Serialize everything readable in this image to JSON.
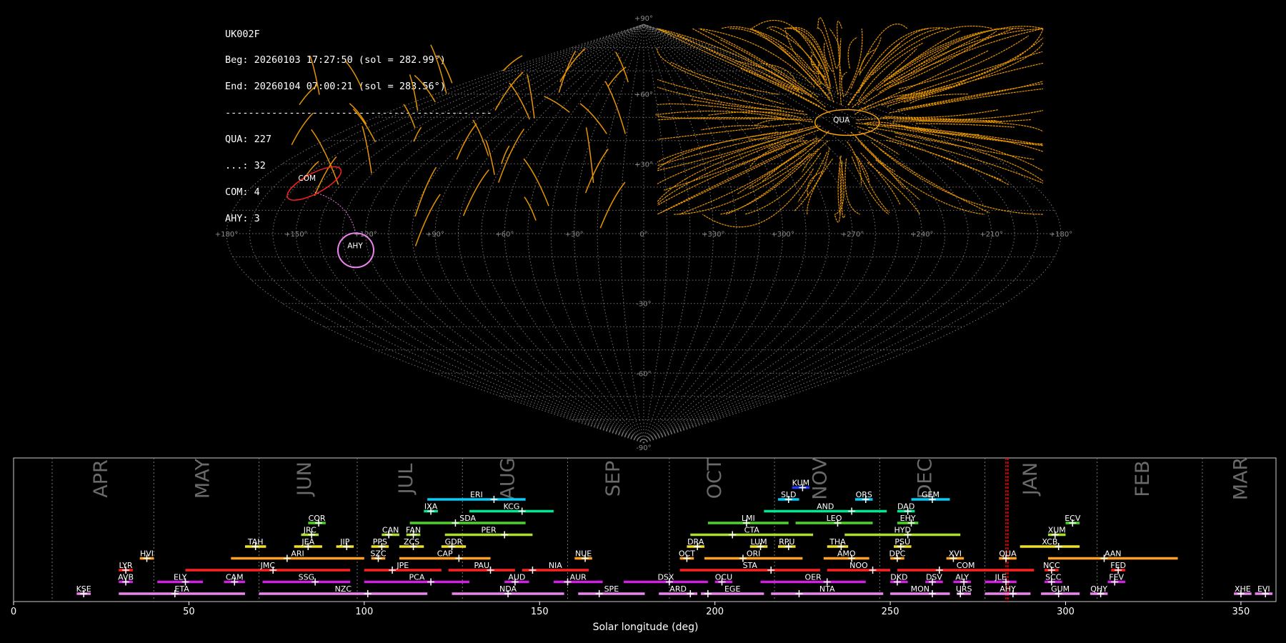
{
  "info": {
    "camera": "UK002F",
    "beg": "Beg: 20260103 17:27:50 (sol = 282.99°)",
    "end": "End: 20260104 07:00:21 (sol = 283.56°)",
    "separator": "----------------------------------------------",
    "counts": [
      "QUA: 227",
      "...: 32",
      "COM: 4",
      "AHY: 3"
    ]
  },
  "colors": {
    "background": "#000000",
    "grid": "#8c8c8c",
    "sporadic": "#ffa500",
    "QUA": "#ff2020",
    "COM": "#ff2020",
    "AHY": "#ee82ee",
    "current_sol": "#ff0000"
  },
  "chart_data": [
    {
      "type": "scatter",
      "projection": "sinusoidal",
      "grid": true,
      "lat_ticks": [
        90,
        60,
        30,
        -30,
        -60,
        -90
      ],
      "lat_labels": [
        "+90°",
        "+60°",
        "+30°",
        "-30°",
        "-60°",
        "-90°"
      ],
      "lon_ticks": [
        180,
        150,
        120,
        90,
        60,
        30,
        0,
        330,
        300,
        270,
        240,
        210,
        180
      ],
      "lon_labels": [
        "+180°",
        "+150°",
        "+120°",
        "+90°",
        "+60°",
        "+30°",
        "0°",
        "+330°",
        "+300°",
        "+270°",
        "+240°",
        "+210°",
        "+180°"
      ],
      "showers": [
        {
          "code": "QUA",
          "lon": 230,
          "lat": 49
        },
        {
          "code": "COM",
          "lon": 159,
          "lat": 24
        },
        {
          "code": "AHY",
          "lon": 125,
          "lat": -5
        }
      ]
    },
    {
      "type": "timeline",
      "xlabel": "Solar longitude (deg)",
      "xlim": [
        0,
        360
      ],
      "xticks": [
        0,
        50,
        100,
        150,
        200,
        250,
        300,
        350
      ],
      "month_lines": [
        11,
        40,
        70,
        98,
        128,
        158,
        187,
        217,
        247,
        277,
        309,
        339
      ],
      "months": [
        {
          "name": "APR",
          "sol": 25
        },
        {
          "name": "MAY",
          "sol": 54
        },
        {
          "name": "JUN",
          "sol": 83
        },
        {
          "name": "JUL",
          "sol": 112
        },
        {
          "name": "AUG",
          "sol": 141
        },
        {
          "name": "SEP",
          "sol": 171
        },
        {
          "name": "OCT",
          "sol": 200
        },
        {
          "name": "NOV",
          "sol": 230
        },
        {
          "name": "DEC",
          "sol": 260
        },
        {
          "name": "JAN",
          "sol": 290
        },
        {
          "name": "FEB",
          "sol": 322
        },
        {
          "name": "MAR",
          "sol": 350
        }
      ],
      "current_sol": [
        282.99,
        283.56
      ],
      "showers": [
        {
          "code": "KUM",
          "start": 222,
          "end": 227,
          "peak": 225,
          "row": 9,
          "color": "#1e3cff"
        },
        {
          "code": "ERI",
          "start": 118,
          "end": 146,
          "peak": 137,
          "row": 8,
          "color": "#00d0ff"
        },
        {
          "code": "SLD",
          "start": 218,
          "end": 224,
          "peak": 221,
          "row": 8,
          "color": "#00d0ff"
        },
        {
          "code": "ORS",
          "start": 240,
          "end": 245,
          "peak": 243,
          "row": 8,
          "color": "#00d0ff"
        },
        {
          "code": "GEM",
          "start": 256,
          "end": 267,
          "peak": 262,
          "row": 8,
          "color": "#00d0ff"
        },
        {
          "code": "IXA",
          "start": 117,
          "end": 121,
          "peak": 119,
          "row": 7,
          "color": "#00e890"
        },
        {
          "code": "KCG",
          "start": 130,
          "end": 154,
          "peak": 145,
          "row": 7,
          "color": "#00e890"
        },
        {
          "code": "AND",
          "start": 214,
          "end": 249,
          "peak": 239,
          "row": 7,
          "color": "#00e890"
        },
        {
          "code": "DAD",
          "start": 252,
          "end": 257,
          "peak": 255,
          "row": 7,
          "color": "#00e890"
        },
        {
          "code": "COR",
          "start": 84,
          "end": 89,
          "peak": 87,
          "row": 6,
          "color": "#50d030"
        },
        {
          "code": "SDA",
          "start": 113,
          "end": 146,
          "peak": 126,
          "row": 6,
          "color": "#50d030"
        },
        {
          "code": "LMI",
          "start": 198,
          "end": 221,
          "peak": 209,
          "row": 6,
          "color": "#50d030"
        },
        {
          "code": "LEO",
          "start": 223,
          "end": 245,
          "peak": 235,
          "row": 6,
          "color": "#50d030"
        },
        {
          "code": "EHY",
          "start": 252,
          "end": 258,
          "peak": 256,
          "row": 6,
          "color": "#50d030"
        },
        {
          "code": "ECV",
          "start": 300,
          "end": 304,
          "peak": 302,
          "row": 6,
          "color": "#50d030"
        },
        {
          "code": "JRC",
          "start": 82,
          "end": 87,
          "peak": 85,
          "row": 5,
          "color": "#a8e030"
        },
        {
          "code": "CAN",
          "start": 105,
          "end": 110,
          "peak": 107,
          "row": 5,
          "color": "#a8e030"
        },
        {
          "code": "FAN",
          "start": 112,
          "end": 116,
          "peak": 114,
          "row": 5,
          "color": "#a8e030"
        },
        {
          "code": "PER",
          "start": 123,
          "end": 148,
          "peak": 140,
          "row": 5,
          "color": "#a8e030"
        },
        {
          "code": "CTA",
          "start": 193,
          "end": 228,
          "peak": 205,
          "row": 5,
          "color": "#a8e030"
        },
        {
          "code": "HYD",
          "start": 237,
          "end": 270,
          "peak": 255,
          "row": 5,
          "color": "#a8e030"
        },
        {
          "code": "XUM",
          "start": 295,
          "end": 300,
          "peak": 297,
          "row": 5,
          "color": "#a8e030"
        },
        {
          "code": "TAH",
          "start": 66,
          "end": 72,
          "peak": 69,
          "row": 4,
          "color": "#f0e020"
        },
        {
          "code": "JEA",
          "start": 80,
          "end": 88,
          "peak": 84,
          "row": 4,
          "color": "#f0e020"
        },
        {
          "code": "JIP",
          "start": 92,
          "end": 97,
          "peak": 95,
          "row": 4,
          "color": "#f0e020"
        },
        {
          "code": "PPS",
          "start": 102,
          "end": 107,
          "peak": 105,
          "row": 4,
          "color": "#f0e020"
        },
        {
          "code": "ZCS",
          "start": 110,
          "end": 117,
          "peak": 114,
          "row": 4,
          "color": "#f0e020"
        },
        {
          "code": "GDR",
          "start": 122,
          "end": 129,
          "peak": 125,
          "row": 4,
          "color": "#f0e020"
        },
        {
          "code": "DRA",
          "start": 192,
          "end": 197,
          "peak": 195,
          "row": 4,
          "color": "#f0e020"
        },
        {
          "code": "LUM",
          "start": 210,
          "end": 215,
          "peak": 213,
          "row": 4,
          "color": "#f0e020"
        },
        {
          "code": "RPU",
          "start": 218,
          "end": 223,
          "peak": 221,
          "row": 4,
          "color": "#f0e020"
        },
        {
          "code": "THA",
          "start": 232,
          "end": 238,
          "peak": 236,
          "row": 4,
          "color": "#f0e020"
        },
        {
          "code": "PSU",
          "start": 251,
          "end": 256,
          "peak": 253,
          "row": 4,
          "color": "#f0e020"
        },
        {
          "code": "XCB",
          "start": 287,
          "end": 304,
          "peak": 298,
          "row": 4,
          "color": "#f0e020"
        },
        {
          "code": "HVI",
          "start": 36,
          "end": 40,
          "peak": 38,
          "row": 3,
          "color": "#ffa020"
        },
        {
          "code": "ARI",
          "start": 62,
          "end": 100,
          "peak": 78,
          "row": 3,
          "color": "#ffa020"
        },
        {
          "code": "SZC",
          "start": 102,
          "end": 106,
          "peak": 104,
          "row": 3,
          "color": "#ffa020"
        },
        {
          "code": "CAP",
          "start": 110,
          "end": 136,
          "peak": 127,
          "row": 3,
          "color": "#ffa020"
        },
        {
          "code": "NUE",
          "start": 160,
          "end": 165,
          "peak": 163,
          "row": 3,
          "color": "#ffa020"
        },
        {
          "code": "OCT",
          "start": 190,
          "end": 194,
          "peak": 192,
          "row": 3,
          "color": "#ffa020"
        },
        {
          "code": "ORI",
          "start": 197,
          "end": 225,
          "peak": 208,
          "row": 3,
          "color": "#ffa020"
        },
        {
          "code": "AMO",
          "start": 231,
          "end": 244,
          "peak": 239,
          "row": 3,
          "color": "#ffa020"
        },
        {
          "code": "DPC",
          "start": 250,
          "end": 254,
          "peak": 252,
          "row": 3,
          "color": "#ffa020"
        },
        {
          "code": "XVI",
          "start": 266,
          "end": 271,
          "peak": 268,
          "row": 3,
          "color": "#ffa020"
        },
        {
          "code": "QUA",
          "start": 281,
          "end": 286,
          "peak": 283,
          "row": 3,
          "color": "#ffa020"
        },
        {
          "code": "AAN",
          "start": 295,
          "end": 332,
          "peak": 311,
          "row": 3,
          "color": "#ffa020"
        },
        {
          "code": "LYR",
          "start": 30,
          "end": 34,
          "peak": 32,
          "row": 2,
          "color": "#ff2020"
        },
        {
          "code": "JMC",
          "start": 49,
          "end": 96,
          "peak": 74,
          "row": 2,
          "color": "#ff2020"
        },
        {
          "code": "JPE",
          "start": 100,
          "end": 122,
          "peak": 108,
          "row": 2,
          "color": "#ff2020"
        },
        {
          "code": "PAU",
          "start": 124,
          "end": 143,
          "peak": 136,
          "row": 2,
          "color": "#ff2020"
        },
        {
          "code": "NIA",
          "start": 145,
          "end": 164,
          "peak": 148,
          "row": 2,
          "color": "#ff2020"
        },
        {
          "code": "STA",
          "start": 190,
          "end": 230,
          "peak": 216,
          "row": 2,
          "color": "#ff2020"
        },
        {
          "code": "NOO",
          "start": 232,
          "end": 250,
          "peak": 245,
          "row": 2,
          "color": "#ff2020"
        },
        {
          "code": "COM",
          "start": 252,
          "end": 291,
          "peak": 264,
          "row": 2,
          "color": "#ff2020"
        },
        {
          "code": "NCC",
          "start": 294,
          "end": 298,
          "peak": 296,
          "row": 2,
          "color": "#ff2020"
        },
        {
          "code": "FED",
          "start": 313,
          "end": 317,
          "peak": 315,
          "row": 2,
          "color": "#ff2020"
        },
        {
          "code": "AVB",
          "start": 30,
          "end": 34,
          "peak": 32,
          "row": 1,
          "color": "#d020e0"
        },
        {
          "code": "ELY",
          "start": 41,
          "end": 54,
          "peak": 49,
          "row": 1,
          "color": "#d020e0"
        },
        {
          "code": "CAM",
          "start": 60,
          "end": 66,
          "peak": 63,
          "row": 1,
          "color": "#d020e0"
        },
        {
          "code": "SSG",
          "start": 71,
          "end": 96,
          "peak": 86,
          "row": 1,
          "color": "#d020e0"
        },
        {
          "code": "PCA",
          "start": 100,
          "end": 130,
          "peak": 119,
          "row": 1,
          "color": "#d020e0"
        },
        {
          "code": "AUD",
          "start": 140,
          "end": 147,
          "peak": 143,
          "row": 1,
          "color": "#d020e0"
        },
        {
          "code": "AUR",
          "start": 154,
          "end": 168,
          "peak": 158,
          "row": 1,
          "color": "#d020e0"
        },
        {
          "code": "DSX",
          "start": 174,
          "end": 198,
          "peak": 187,
          "row": 1,
          "color": "#d020e0"
        },
        {
          "code": "OCU",
          "start": 200,
          "end": 205,
          "peak": 202,
          "row": 1,
          "color": "#d020e0"
        },
        {
          "code": "OER",
          "start": 213,
          "end": 243,
          "peak": 232,
          "row": 1,
          "color": "#d020e0"
        },
        {
          "code": "DKD",
          "start": 250,
          "end": 255,
          "peak": 252,
          "row": 1,
          "color": "#d020e0"
        },
        {
          "code": "DSV",
          "start": 260,
          "end": 265,
          "peak": 262,
          "row": 1,
          "color": "#d020e0"
        },
        {
          "code": "ALY",
          "start": 268,
          "end": 273,
          "peak": 271,
          "row": 1,
          "color": "#d020e0"
        },
        {
          "code": "JLE",
          "start": 277,
          "end": 286,
          "peak": 283,
          "row": 1,
          "color": "#d020e0"
        },
        {
          "code": "SCC",
          "start": 294,
          "end": 299,
          "peak": 296,
          "row": 1,
          "color": "#d020e0"
        },
        {
          "code": "FEV",
          "start": 312,
          "end": 317,
          "peak": 314,
          "row": 1,
          "color": "#d020e0"
        },
        {
          "code": "KSE",
          "start": 18,
          "end": 22,
          "peak": 20,
          "row": 0,
          "color": "#ee82ee"
        },
        {
          "code": "ETA",
          "start": 30,
          "end": 66,
          "peak": 46,
          "row": 0,
          "color": "#ee82ee"
        },
        {
          "code": "NZC",
          "start": 70,
          "end": 118,
          "peak": 101,
          "row": 0,
          "color": "#ee82ee"
        },
        {
          "code": "NDA",
          "start": 125,
          "end": 157,
          "peak": 141,
          "row": 0,
          "color": "#ee82ee"
        },
        {
          "code": "SPE",
          "start": 161,
          "end": 180,
          "peak": 167,
          "row": 0,
          "color": "#ee82ee"
        },
        {
          "code": "ARD",
          "start": 184,
          "end": 195,
          "peak": 193,
          "row": 0,
          "color": "#ee82ee"
        },
        {
          "code": "EGE",
          "start": 196,
          "end": 214,
          "peak": 198,
          "row": 0,
          "color": "#ee82ee"
        },
        {
          "code": "NTA",
          "start": 216,
          "end": 248,
          "peak": 224,
          "row": 0,
          "color": "#ee82ee"
        },
        {
          "code": "MON",
          "start": 250,
          "end": 267,
          "peak": 262,
          "row": 0,
          "color": "#ee82ee"
        },
        {
          "code": "URS",
          "start": 269,
          "end": 273,
          "peak": 270,
          "row": 0,
          "color": "#ee82ee"
        },
        {
          "code": "AHY",
          "start": 277,
          "end": 290,
          "peak": 285,
          "row": 0,
          "color": "#ee82ee"
        },
        {
          "code": "GUM",
          "start": 293,
          "end": 304,
          "peak": 298,
          "row": 0,
          "color": "#ee82ee"
        },
        {
          "code": "QHY",
          "start": 307,
          "end": 312,
          "peak": 310,
          "row": 0,
          "color": "#ee82ee"
        },
        {
          "code": "XHE",
          "start": 348,
          "end": 353,
          "peak": 350,
          "row": 0,
          "color": "#ee82ee"
        },
        {
          "code": "EVI",
          "start": 354,
          "end": 359,
          "peak": 357,
          "row": 0,
          "color": "#ee82ee"
        }
      ]
    }
  ]
}
